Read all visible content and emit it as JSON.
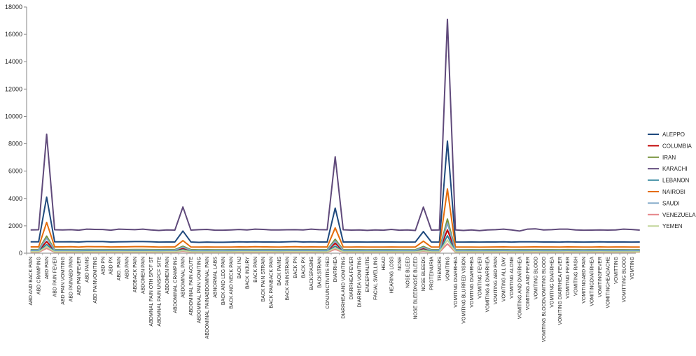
{
  "chart_data": {
    "type": "line",
    "title": "",
    "xlabel": "",
    "ylabel": "",
    "ylim": [
      0,
      18000
    ],
    "y_ticks": [
      "0",
      "2000",
      "4000",
      "6000",
      "8000",
      "10000",
      "12000",
      "14000",
      "16000",
      "18000"
    ],
    "grid": false,
    "legend_position": "right",
    "categories": [
      "ABD AND BACK PAIN",
      "ABD CRAMPING",
      "ABD PAIN",
      "ABD PAIN FEVER",
      "ABD PAIN VOMITING",
      "ABD PAINABD PAIN",
      "ABD PAINFEVER",
      "ABD PAINS",
      "ABD PAINVOMITING",
      "ABD PN",
      "ABD PX",
      "ABD. PAIN",
      "ABD.PAIN",
      "ABDBACK PAIN",
      "ABDOMEN PAIN",
      "ABDMNAL PAIN OTH SPCF ST",
      "ABDMNAL PAIN UNSPCF SITE",
      "ABDOMEN PAIN",
      "ABDOMINAL CRAMPING",
      "ABDOMINAL PAIN",
      "ABDOMINAL PAIN ACUTE",
      "ABDOMINAL PAIN VOMITING",
      "ABDOMINAL PAINABDOMINAL PAIN",
      "ABNORMAL LABS",
      "BACK AND LEG PAIN",
      "BACK AND NECK PAIN",
      "BACK INJ",
      "BACK INJURY",
      "BACK PAIN",
      "BACK PAIN STRAIN",
      "BACK PAINBACK PAIN",
      "BACK PAINS",
      "BACK PAINSTRAIN",
      "BACK PN",
      "BACK PX",
      "BACKSPASMS",
      "BACKSTRAIN",
      "CONJUNCTIVITIS RED",
      "DIARRHEA",
      "DIARRHEA AND VOMITING",
      "DIARRHEA FEVER",
      "DIARRHEA VOMITING",
      "ENCEPHALITIS",
      "FACIAL SWELLING",
      "HEAD",
      "HEARING LOSS",
      "NOSE",
      "NOSE BLEED",
      "NOSE BLEEDNOSE BLEED",
      "NOSE BLEEDS",
      "PROTEINURIA",
      "TREMORS",
      "VOMITING",
      "VOMITING   DIARRHEA",
      "VOMITING  BLURRED VISION",
      "VOMITING  DIARRHEA",
      "VOMITING  FEVER",
      "VOMITING & DIARRHEA",
      "VOMITING ABD PAIN",
      "VOMITING ALL DAY",
      "VOMITING ALONE",
      "VOMITING AND DIARRHEA",
      "VOMITING AND FEVER",
      "VOMITING BLOOD",
      "VOMITING BLOODVOMITING BLOOD",
      "VOMITING DIARRHEA",
      "VOMITING DIARRHEA FEVER",
      "VOMITING FEVER",
      "VOMITING RASH",
      "VOMITINGABD PAIN",
      "VOMITINGDIARRHEA",
      "VOMITINGFEVER",
      "VOMITINGHEADACHE",
      "VOMITTING",
      "VOMITTING  BLOOD",
      "VOMTING"
    ],
    "series": [
      {
        "name": "ALEPPO",
        "color": "#1f497d",
        "values": [
          830,
          830,
          4100,
          830,
          830,
          840,
          820,
          850,
          850,
          850,
          820,
          830,
          840,
          850,
          850,
          840,
          810,
          820,
          820,
          1620,
          820,
          790,
          810,
          800,
          800,
          810,
          830,
          820,
          830,
          820,
          820,
          810,
          830,
          850,
          820,
          830,
          820,
          820,
          3300,
          820,
          820,
          820,
          810,
          820,
          820,
          820,
          810,
          810,
          820,
          1580,
          820,
          810,
          8200,
          820,
          810,
          820,
          810,
          820,
          820,
          830,
          810,
          830,
          830,
          830,
          820,
          820,
          810,
          830,
          820,
          810,
          820,
          830,
          820,
          820,
          820,
          810,
          820
        ]
      },
      {
        "name": "COLUMBIA",
        "color": "#c00000",
        "values": [
          180,
          180,
          850,
          180,
          180,
          185,
          175,
          190,
          185,
          185,
          180,
          180,
          185,
          190,
          190,
          185,
          180,
          180,
          180,
          360,
          180,
          175,
          180,
          175,
          175,
          180,
          180,
          180,
          185,
          180,
          180,
          180,
          180,
          185,
          180,
          180,
          180,
          180,
          720,
          180,
          180,
          180,
          175,
          180,
          180,
          180,
          175,
          175,
          180,
          350,
          180,
          180,
          1700,
          180,
          180,
          180,
          175,
          180,
          180,
          185,
          175,
          180,
          180,
          185,
          180,
          180,
          175,
          185,
          180,
          175,
          180,
          185,
          180,
          180,
          180,
          175,
          180
        ]
      },
      {
        "name": "IRAN",
        "color": "#77933c",
        "values": [
          260,
          260,
          1250,
          260,
          260,
          265,
          255,
          270,
          265,
          265,
          260,
          260,
          265,
          270,
          270,
          265,
          255,
          260,
          260,
          510,
          260,
          250,
          255,
          250,
          250,
          255,
          260,
          260,
          265,
          260,
          260,
          255,
          260,
          265,
          260,
          260,
          255,
          255,
          1020,
          255,
          255,
          255,
          250,
          255,
          255,
          255,
          250,
          250,
          255,
          490,
          255,
          255,
          2500,
          255,
          250,
          255,
          250,
          255,
          255,
          260,
          250,
          255,
          255,
          260,
          255,
          255,
          250,
          260,
          255,
          250,
          255,
          260,
          255,
          255,
          255,
          250,
          255
        ]
      },
      {
        "name": "KARACHI",
        "color": "#604a7b",
        "values": [
          1700,
          1710,
          8700,
          1710,
          1700,
          1720,
          1680,
          1760,
          1740,
          1730,
          1680,
          1760,
          1740,
          1720,
          1760,
          1700,
          1660,
          1700,
          1690,
          3380,
          1690,
          1720,
          1740,
          1680,
          1680,
          1700,
          1730,
          1700,
          1760,
          1740,
          1700,
          1700,
          1710,
          1720,
          1700,
          1760,
          1720,
          1710,
          7050,
          1710,
          1690,
          1700,
          1670,
          1700,
          1680,
          1740,
          1680,
          1700,
          1660,
          3370,
          1690,
          1700,
          17100,
          1700,
          1660,
          1700,
          1650,
          1700,
          1720,
          1760,
          1700,
          1620,
          1760,
          1780,
          1700,
          1720,
          1760,
          1760,
          1700,
          1680,
          1690,
          1700,
          1690,
          1700,
          1760,
          1730,
          1690
        ]
      },
      {
        "name": "LEBANON",
        "color": "#31859c",
        "values": [
          130,
          130,
          640,
          130,
          130,
          135,
          128,
          138,
          135,
          135,
          130,
          130,
          135,
          138,
          138,
          135,
          128,
          130,
          130,
          260,
          130,
          126,
          130,
          128,
          128,
          130,
          132,
          130,
          134,
          130,
          130,
          128,
          130,
          135,
          130,
          132,
          130,
          130,
          520,
          130,
          130,
          130,
          128,
          130,
          130,
          130,
          128,
          128,
          130,
          250,
          130,
          130,
          1280,
          130,
          128,
          130,
          126,
          130,
          130,
          132,
          128,
          130,
          130,
          132,
          130,
          130,
          128,
          132,
          130,
          128,
          130,
          132,
          130,
          130,
          130,
          128,
          130
        ]
      },
      {
        "name": "NAIROBI",
        "color": "#e46c0a",
        "values": [
          460,
          460,
          2250,
          460,
          460,
          470,
          450,
          480,
          470,
          470,
          455,
          460,
          465,
          480,
          480,
          465,
          450,
          455,
          455,
          920,
          455,
          445,
          455,
          445,
          445,
          450,
          460,
          455,
          470,
          460,
          455,
          450,
          460,
          470,
          455,
          460,
          455,
          455,
          1850,
          455,
          450,
          455,
          445,
          450,
          450,
          455,
          445,
          445,
          450,
          880,
          450,
          450,
          4700,
          455,
          445,
          450,
          440,
          450,
          455,
          460,
          445,
          450,
          455,
          460,
          455,
          455,
          445,
          460,
          455,
          445,
          450,
          460,
          450,
          455,
          455,
          445,
          450
        ]
      },
      {
        "name": "SAUDI",
        "color": "#7fa7c7",
        "values": [
          220,
          220,
          1100,
          220,
          220,
          225,
          215,
          230,
          225,
          225,
          220,
          220,
          225,
          230,
          230,
          225,
          215,
          220,
          220,
          440,
          220,
          210,
          215,
          210,
          210,
          215,
          220,
          220,
          225,
          220,
          220,
          215,
          220,
          225,
          220,
          220,
          215,
          215,
          890,
          215,
          215,
          215,
          210,
          215,
          215,
          215,
          210,
          210,
          215,
          420,
          215,
          215,
          2200,
          215,
          210,
          215,
          210,
          215,
          215,
          220,
          210,
          215,
          215,
          220,
          215,
          215,
          210,
          220,
          215,
          210,
          215,
          220,
          215,
          215,
          215,
          210,
          215
        ]
      },
      {
        "name": "VENEZUELA",
        "color": "#e6868a",
        "values": [
          70,
          70,
          350,
          70,
          70,
          72,
          68,
          74,
          72,
          72,
          70,
          70,
          72,
          74,
          74,
          72,
          68,
          70,
          70,
          140,
          70,
          68,
          70,
          68,
          68,
          70,
          70,
          70,
          72,
          70,
          70,
          68,
          70,
          72,
          70,
          70,
          70,
          70,
          285,
          70,
          70,
          70,
          68,
          70,
          70,
          70,
          68,
          68,
          70,
          135,
          70,
          70,
          690,
          70,
          68,
          70,
          68,
          70,
          70,
          72,
          68,
          70,
          70,
          72,
          70,
          70,
          68,
          72,
          70,
          68,
          70,
          72,
          70,
          70,
          70,
          68,
          70
        ]
      },
      {
        "name": "YEMEN",
        "color": "#c3d69b",
        "values": [
          100,
          100,
          480,
          100,
          100,
          102,
          98,
          104,
          102,
          102,
          100,
          100,
          102,
          104,
          104,
          102,
          98,
          100,
          100,
          200,
          100,
          96,
          98,
          96,
          96,
          98,
          100,
          100,
          102,
          100,
          100,
          98,
          100,
          102,
          100,
          100,
          98,
          98,
          390,
          98,
          98,
          98,
          96,
          98,
          98,
          98,
          96,
          96,
          98,
          190,
          98,
          98,
          960,
          98,
          96,
          98,
          96,
          98,
          98,
          100,
          96,
          98,
          98,
          100,
          98,
          98,
          96,
          100,
          98,
          96,
          98,
          100,
          98,
          98,
          98,
          96,
          98
        ]
      }
    ]
  }
}
